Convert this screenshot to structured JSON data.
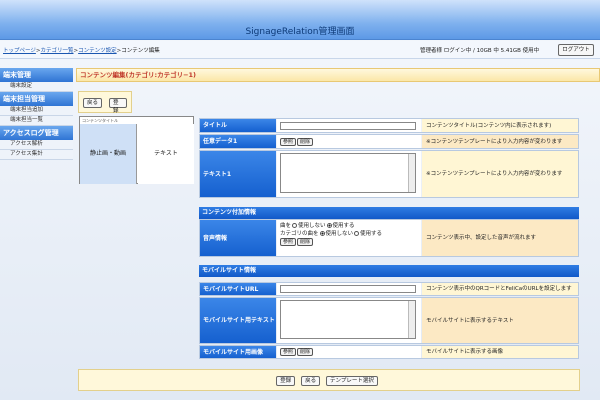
{
  "header": {
    "title": "SignageRelation管理画面"
  },
  "breadcrumb": {
    "items": [
      "トップページ",
      "カテゴリ一覧",
      "コンテンツ設定"
    ],
    "current": "コンテンツ編集"
  },
  "user": {
    "info": "管理者様 ログイン中 / 10GB 中 5.41GB 使用中",
    "logout_label": "ログアウト"
  },
  "sidebar": {
    "sections": [
      {
        "title": "端末管理",
        "items": [
          "端末設定"
        ]
      },
      {
        "title": "端末担当管理",
        "items": [
          "端末担当追加",
          "端末担当一覧"
        ]
      },
      {
        "title": "アクセスログ管理",
        "items": [
          "アクセス解析",
          "アクセス集計"
        ]
      }
    ]
  },
  "page": {
    "title": "コンテンツ編集(カテゴリ:カテゴリ−1)"
  },
  "buttons": {
    "back": "戻る",
    "register": "登録",
    "template_select": "テンプレート選択",
    "ref": "参照",
    "delete": "削除"
  },
  "preview": {
    "label": "コンテンツタイトル",
    "left": "静止画・動画",
    "right": "テキスト"
  },
  "form": {
    "title": {
      "label": "タイトル",
      "value": "",
      "note": "コンテンツタイトル(コンテンツ内に表示されます)"
    },
    "optional_data1": {
      "label": "任意データ1",
      "note": "※コンテンツテンプレートにより入力内容が変わります"
    },
    "text1": {
      "label": "テキスト1",
      "value": "",
      "note": "※コンテンツテンプレートにより入力内容が変わります"
    },
    "section_content_extra": "コンテンツ付加情報",
    "audio": {
      "label": "音声情報",
      "song_label": "曲を",
      "category_song_label": "カテゴリの曲を",
      "opt_unused": "使用しない",
      "opt_used": "使用する",
      "note": "コンテンツ表示中、設定した音声が流れます"
    },
    "section_mobile": "モバイルサイト情報",
    "mobile_url": {
      "label": "モバイルサイトURL",
      "value": "",
      "note": "コンテンツ表示中のQRコードとFeliCaのURLを設定します"
    },
    "mobile_text": {
      "label": "モバイルサイト用テキスト",
      "value": "",
      "note": "モバイルサイトに表示するテキスト"
    },
    "mobile_image": {
      "label": "モバイルサイト用画像",
      "note": "モバイルサイトに表示する画像"
    }
  },
  "colors": {
    "accent": "#1560cf",
    "header": "#7fb1ee",
    "note_bg": "#fff6d4",
    "title_text": "#c0392b"
  }
}
